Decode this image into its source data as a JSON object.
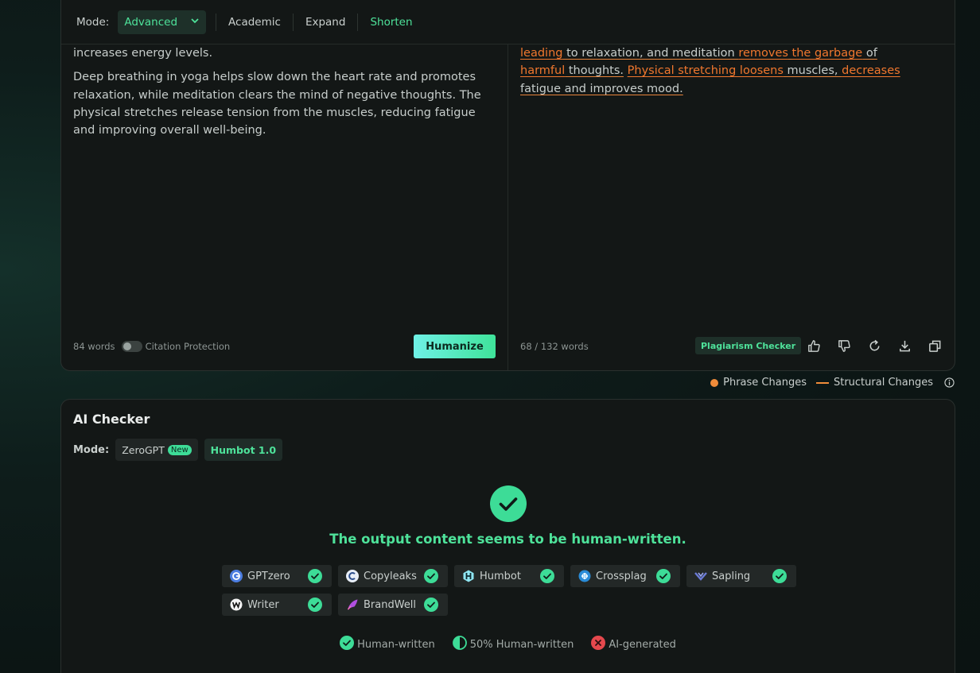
{
  "mode_bar": {
    "label": "Mode:",
    "selected": "Advanced",
    "options": [
      "Academic",
      "Expand",
      "Shorten"
    ],
    "active_option": "Shorten"
  },
  "input": {
    "paragraphs": [
      "increases energy levels.",
      "Deep breathing in yoga helps slow down the heart rate and promotes relaxation, while meditation clears the mind of negative thoughts. The physical stretches release tension from the muscles, reducing fatigue and improving overall well-being."
    ],
    "word_count": "84 words",
    "citation_protection_label": "Citation Protection",
    "citation_protection_on": false,
    "humanize_label": "Humanize"
  },
  "output": {
    "segments": [
      {
        "text": "leading",
        "type": "phrase"
      },
      {
        "text": " to relaxation, and meditation ",
        "type": "structural"
      },
      {
        "text": "removes",
        "type": "phrase"
      },
      {
        "text": " ",
        "type": "structural"
      },
      {
        "text": "the garbage",
        "type": "phrase"
      },
      {
        "text": " of ",
        "type": "structural"
      },
      {
        "text": "harmful",
        "type": "phrase"
      },
      {
        "text": " thoughts.",
        "type": "structural"
      },
      {
        "text": " ",
        "type": "plain"
      },
      {
        "text": "Physical stretching loosens",
        "type": "phrase"
      },
      {
        "text": " muscles, ",
        "type": "structural"
      },
      {
        "text": "decreases",
        "type": "phrase"
      },
      {
        "text": " fatigue and improves mood.",
        "type": "structural"
      }
    ],
    "word_count": "68 / 132 words",
    "plagiarism_label": "Plagiarism Checker"
  },
  "legend": {
    "phrase": "Phrase Changes",
    "structural": "Structural Changes",
    "phrase_color": "#f08c3a",
    "structural_color": "#f08c3a"
  },
  "ai_checker": {
    "title": "AI Checker",
    "mode_label": "Mode:",
    "modes": [
      {
        "label": "ZeroGPT",
        "badge": "New"
      },
      {
        "label": "Humbot 1.0"
      }
    ],
    "verdict": "The output content seems to be human-written.",
    "detectors": [
      {
        "name": "GPTzero",
        "icon": "gptzero-icon",
        "status": "human"
      },
      {
        "name": "Copyleaks",
        "icon": "copyleaks-icon",
        "status": "human"
      },
      {
        "name": "Humbot",
        "icon": "humbot-icon",
        "status": "human"
      },
      {
        "name": "Crossplag",
        "icon": "crossplag-icon",
        "status": "human"
      },
      {
        "name": "Sapling",
        "icon": "sapling-icon",
        "status": "human"
      },
      {
        "name": "Writer",
        "icon": "writer-icon",
        "status": "human"
      },
      {
        "name": "BrandWell",
        "icon": "brandwell-icon",
        "status": "human"
      }
    ],
    "key": {
      "human": "Human-written",
      "half": "50% Human-written",
      "ai": "AI-generated"
    }
  },
  "colors": {
    "accent": "#4ee29a",
    "phrase_change": "#f0772e",
    "ai_red": "#e5484d"
  }
}
